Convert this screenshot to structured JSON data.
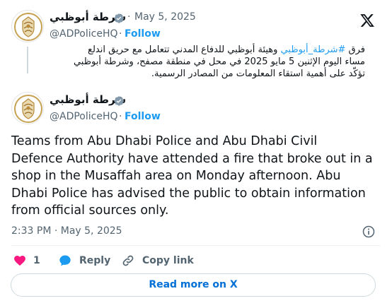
{
  "quoted_post": {
    "author_name": "شرطة أبوظبي",
    "handle": "@ADPoliceHQ",
    "date": "May 5, 2025",
    "follow_label": "Follow",
    "separator": "·",
    "text_line1_prefix": "فرق ",
    "text_line1_hashtag": "#شرطة_أبوظبي",
    "text_line1_rest": " وهيئة أبوظبي للدفاع المدني تتعامل مع حريق اندلع",
    "text_line2": "مساء اليوم الإثنين 5 مايو 2025 في محل في منطقة مصفح، وشرطة أبوظبي",
    "text_line3": "تؤكّد على أهمية استقاء المعلومات من المصادر الرسمية."
  },
  "main_post": {
    "author_name": "شرطة أبوظبي",
    "handle": "@ADPoliceHQ",
    "follow_label": "Follow",
    "separator": "·",
    "text_lines": [
      "Teams from Abu Dhabi Police and Abu Dhabi Civil",
      "Defence Authority have attended a fire that broke out in a",
      "shop in the Musaffah area on Monday afternoon. Abu",
      "Dhabi Police has advised the public to obtain information",
      "from official sources only."
    ],
    "timestamp": "2:33 PM · May 5, 2025"
  },
  "actions": {
    "like_count": "1",
    "reply_label": "Reply",
    "copy_link_label": "Copy link"
  },
  "read_more_label": "Read more on X",
  "colors": {
    "link_blue": "#1d9bf0",
    "like_red": "#f91880",
    "reply_blue": "#1d9bf0",
    "muted": "#536471",
    "gold": "#c8a253"
  },
  "icons": [
    "x-logo-icon",
    "verified-badge-icon",
    "heart-icon",
    "reply-bubble-icon",
    "link-icon",
    "info-icon",
    "police-emblem-icon"
  ]
}
